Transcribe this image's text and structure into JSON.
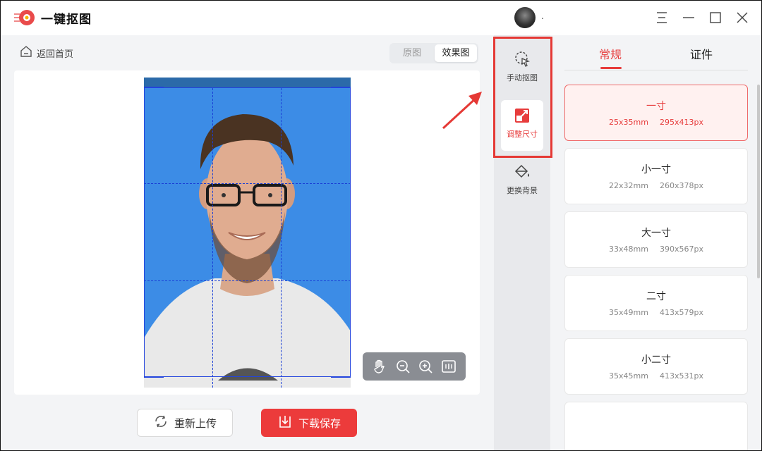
{
  "app": {
    "title": "一键抠图",
    "user_name": "."
  },
  "nav": {
    "back_label": "返回首页"
  },
  "view_toggle": {
    "original_label": "原图",
    "effect_label": "效果图",
    "selected": "效果图"
  },
  "actions": {
    "reupload_label": "重新上传",
    "download_label": "下载保存"
  },
  "tools": [
    {
      "label": "手动抠图",
      "icon": "cursor-select-icon"
    },
    {
      "label": "调整尺寸",
      "icon": "resize-icon",
      "active": true
    },
    {
      "label": "更换背景",
      "icon": "paint-bucket-icon"
    }
  ],
  "tabs": {
    "regular_label": "常规",
    "certificate_label": "证件",
    "selected": "常规"
  },
  "sizes": [
    {
      "name": "一寸",
      "mm": "25x35mm",
      "px": "295x413px",
      "selected": true
    },
    {
      "name": "小一寸",
      "mm": "22x32mm",
      "px": "260x378px"
    },
    {
      "name": "大一寸",
      "mm": "33x48mm",
      "px": "390x567px"
    },
    {
      "name": "二寸",
      "mm": "35x49mm",
      "px": "413x579px"
    },
    {
      "name": "小二寸",
      "mm": "35x45mm",
      "px": "413x531px"
    },
    {
      "name": "",
      "mm": "",
      "px": ""
    }
  ],
  "zoom_tools": [
    "hand-icon",
    "zoom-out-icon",
    "zoom-in-icon",
    "fit-icon"
  ],
  "colors": {
    "accent": "#e73c3c",
    "photo_background": "#3c8ce6",
    "guide_lines": "#1a3fd6"
  }
}
